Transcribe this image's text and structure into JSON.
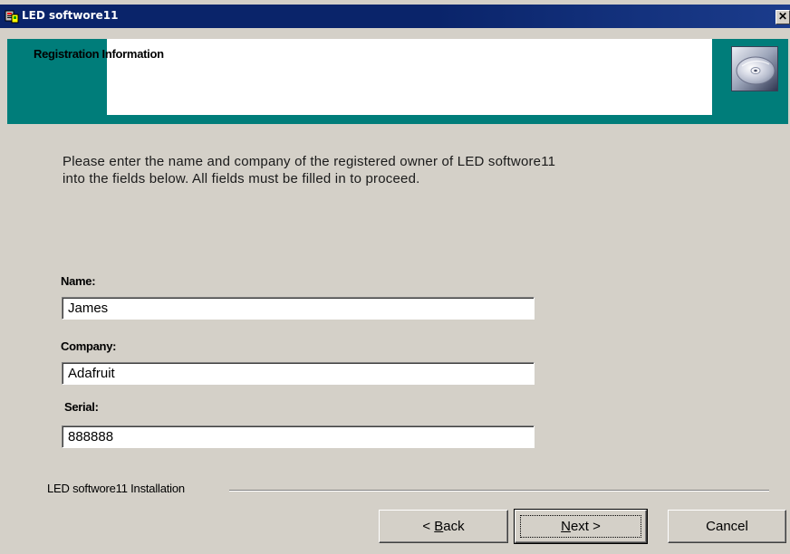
{
  "window": {
    "title": "LED softwore11",
    "close_glyph": "✕"
  },
  "header": {
    "title": "Registration Information",
    "icon": "cd-icon"
  },
  "instructions": {
    "line1": "Please enter the name and company of the registered owner of LED softwore11",
    "line2": "into the fields below. All fields must be filled in to proceed."
  },
  "form": {
    "name_label": "Name:",
    "name_value": "James",
    "company_label": "Company:",
    "company_value": "Adafruit",
    "serial_label": "Serial:",
    "serial_value": "888888"
  },
  "footer": {
    "group_label": "LED softwore11 Installation",
    "back_mnemonic": "B",
    "back_rest": "ack",
    "back_prefix": "< ",
    "next_mnemonic": "N",
    "next_rest": "ext >",
    "cancel_label": "Cancel"
  },
  "colors": {
    "banner": "#007d7a",
    "titlebar": "#0a246a",
    "dialog": "#d4d0c8"
  }
}
